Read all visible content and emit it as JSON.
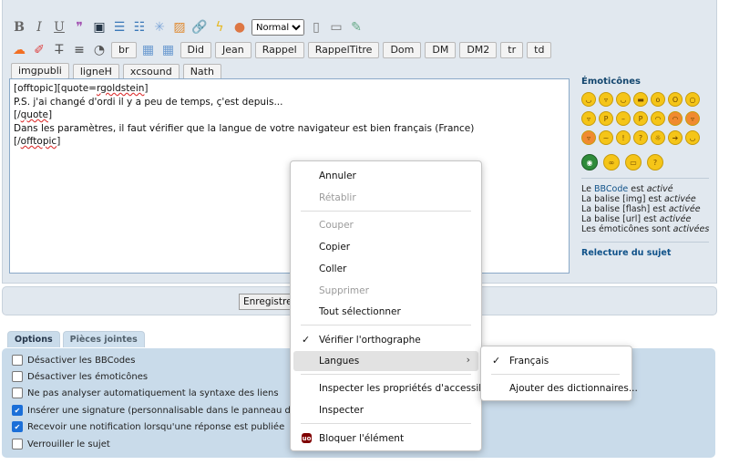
{
  "toolbar": {
    "font_size_selected": "Normale",
    "buttons_row1": [
      "br",
      "Did",
      "Jean",
      "Rappel",
      "RappelTitre",
      "Dom",
      "DM",
      "DM2",
      "tr",
      "td",
      "imgpubli"
    ],
    "buttons_row2": [
      "ligneH",
      "xcsound",
      "Nath"
    ]
  },
  "editor": {
    "line1_a": "[offtopic][quote=",
    "line1_b": "rgoldstein",
    "line1_c": "]",
    "line2": "P.S. j'ai changé d'ordi il y a peu de temps, ç'est depuis...",
    "line3_a": "[/",
    "line3_b": "quote",
    "line3_c": "]",
    "line4": "Dans les paramètres, il faut vérifier que la langue de votre navigateur est bien français (France)",
    "line5_a": "[/",
    "line5_b": "offtopic",
    "line5_c": "]"
  },
  "sidebar": {
    "title": "Émoticônes",
    "bbcode_prefix": "Le ",
    "bbcode_link": "BBCode",
    "bbcode_mid": " est ",
    "bbcode_state": "activé",
    "img_text": "La balise [img] est ",
    "img_state": "activée",
    "flash_text": "La balise [flash] est ",
    "flash_state": "activée",
    "url_text": "La balise [url] est ",
    "url_state": "activée",
    "emo_text": "Les émoticônes sont ",
    "emo_state": "activées",
    "relecture": "Relecture du sujet"
  },
  "save_button": "Enregistrer",
  "tabs": [
    {
      "label": "Options"
    },
    {
      "label": "Pièces jointes"
    }
  ],
  "options": [
    {
      "label": "Désactiver les BBCodes",
      "checked": false
    },
    {
      "label": "Désactiver les émoticônes",
      "checked": false
    },
    {
      "label": "Ne pas analyser automatiquement la syntaxe des liens",
      "checked": false
    },
    {
      "label": "Insérer une signature (personnalisable dans le panneau de contrô",
      "checked": true
    },
    {
      "label": "Recevoir une notification lorsqu'une réponse est publiée",
      "checked": true
    },
    {
      "label": "Verrouiller le sujet",
      "checked": false
    }
  ],
  "context_menu": {
    "annuler": "Annuler",
    "retablir": "Rétablir",
    "couper": "Couper",
    "copier": "Copier",
    "coller": "Coller",
    "supprimer": "Supprimer",
    "tout_selectionner": "Tout sélectionner",
    "verifier": "Vérifier l'orthographe",
    "langues": "Langues",
    "inspecter_access": "Inspecter les propriétés d'accessibilité",
    "inspecter": "Inspecter",
    "bloquer": "Bloquer l'élément"
  },
  "submenu": {
    "francais": "Français",
    "ajouter": "Ajouter des dictionnaires..."
  }
}
